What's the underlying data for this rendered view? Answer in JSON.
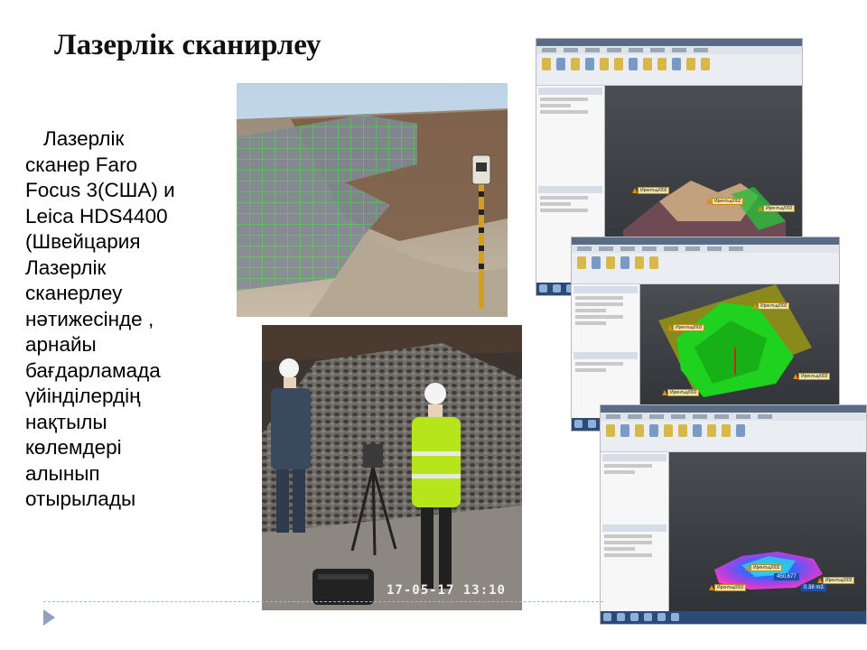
{
  "slide": {
    "title": "Лазерлік сканирлеу",
    "body_lines": [
      "Лазерлік",
      "сканер Faro",
      "Focus 3(США)  и",
      "Leica HDS4400",
      "(Швейцария",
      "Лазерлік",
      "сканерлеу",
      "нәтижесінде ,",
      "арнайы",
      "бағдарламада",
      "үйінділердің",
      "нақтылы",
      "көлемдері",
      "алынып",
      "отырылады"
    ]
  },
  "photos": {
    "field_timestamp": "17-05-17 13:10"
  },
  "screens": {
    "tag_text": "Ирентьц/002",
    "volume_value": "450,677",
    "volume_unit": "0.38 m3"
  },
  "colors": {
    "accent_green": "#1fd21f",
    "ribbon": "#eaedf1",
    "viewport": "#3c3f44",
    "nav_arrow": "#8ea2bc"
  },
  "icons": {
    "nav": "triangle-right-icon"
  }
}
